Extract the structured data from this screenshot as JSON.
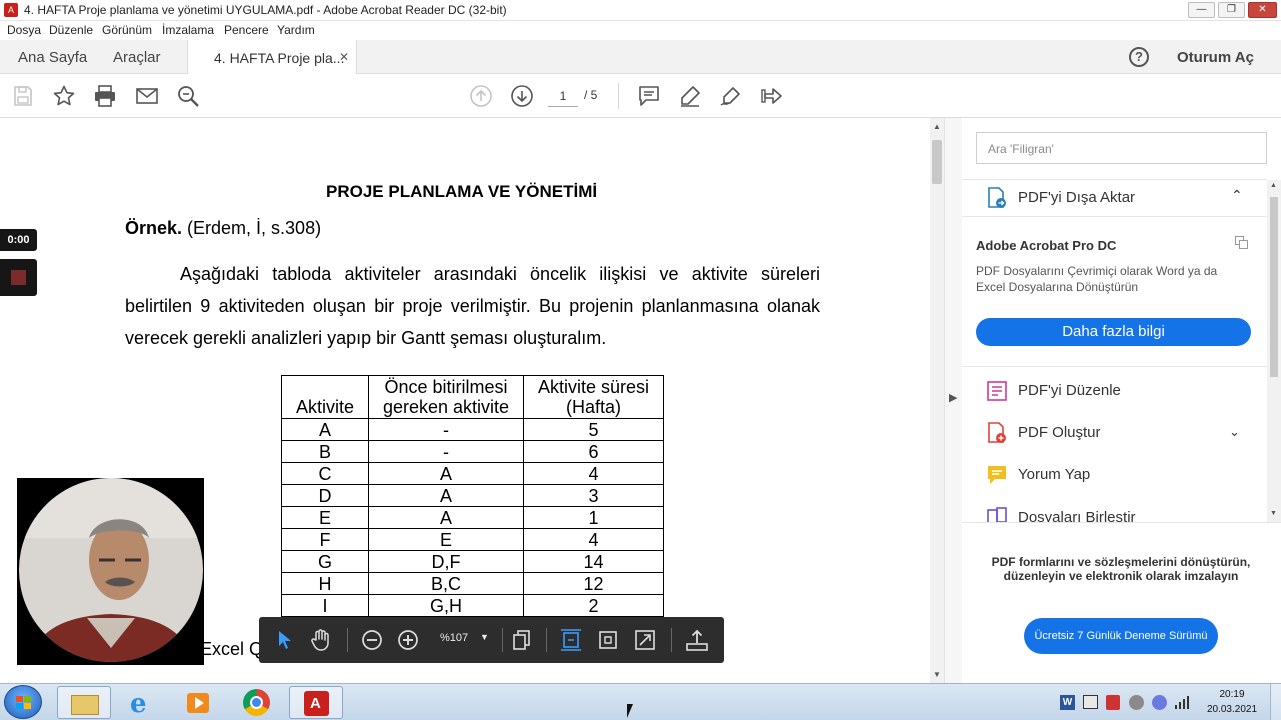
{
  "window": {
    "title": "4. HAFTA Proje planlama ve yönetimi UYGULAMA.pdf - Adobe Acrobat Reader DC (32-bit)",
    "app_icon_glyph": "A",
    "minimize": "—",
    "maximize": "❐",
    "close": "✕"
  },
  "menu": [
    "Dosya",
    "Düzenle",
    "Görünüm",
    "İmzalama",
    "Pencere",
    "Yardım"
  ],
  "tabs": {
    "home": "Ana Sayfa",
    "tools": "Araçlar",
    "document": "4. HAFTA Proje pla...",
    "close_glyph": "✕",
    "help_glyph": "?",
    "sign_in": "Oturum Aç"
  },
  "toolbar": {
    "page_current": "1",
    "page_total": "/ 5",
    "icons": [
      "save-icon",
      "bookmark-star-icon",
      "print-icon",
      "email-icon",
      "zoom-search-icon",
      "page-up-icon",
      "page-down-icon",
      "comment-icon",
      "highlight-pen-icon",
      "sign-icon",
      "share-icon"
    ]
  },
  "document": {
    "title": "PROJE PLANLAMA VE YÖNETİMİ",
    "example_label": "Örnek.",
    "example_ref": " (Erdem, İ, s.308)",
    "paragraph_lines": [
      "Aşağıdaki tabloda aktiviteler arasındaki öncelik ilişkisi ve aktivite süreleri",
      "belirtilen 9 aktiviteden oluşan bir proje verilmiştir. Bu projenin planlanmasına olanak",
      "verecek gerekli analizleri yapıp bir Gantt şeması oluşturalım."
    ],
    "table": {
      "headers": [
        "Aktivite",
        "Önce bitirilmesi\ngereken aktivite",
        "Aktivite süresi\n(Hafta)"
      ],
      "rows": [
        [
          "A",
          "-",
          "5"
        ],
        [
          "B",
          "-",
          "6"
        ],
        [
          "C",
          "A",
          "4"
        ],
        [
          "D",
          "A",
          "3"
        ],
        [
          "E",
          "A",
          "1"
        ],
        [
          "F",
          "E",
          "4"
        ],
        [
          "G",
          "D,F",
          "14"
        ],
        [
          "H",
          "B,C",
          "12"
        ],
        [
          "I",
          "G,H",
          "2"
        ]
      ]
    },
    "partial_text": "Excel Q"
  },
  "float_toolbar": {
    "zoom": "%107",
    "icons": [
      "select-cursor-icon",
      "hand-pan-icon",
      "zoom-out-icon",
      "zoom-in-icon",
      "zoom-dropdown-icon",
      "page-view-icon",
      "fit-page-icon",
      "rotate-icon",
      "fullscreen-icon",
      "export-icon"
    ]
  },
  "recorder": {
    "timer": "0:00"
  },
  "right_panel": {
    "search_placeholder": "Ara 'Filigran'",
    "export_pdf": "PDF'yi Dışa Aktar",
    "promo_title": "Adobe Acrobat Pro DC",
    "promo_text": "PDF Dosyalarını Çevrimiçi olarak Word ya da Excel Dosyalarına Dönüştürün",
    "more_info": "Daha fazla bilgi",
    "tools": [
      "PDF'yi Düzenle",
      "PDF Oluştur",
      "Yorum Yap",
      "Dosyaları Birleştir"
    ],
    "footer_text": "PDF formlarını ve sözleşmelerini dönüştürün, düzenleyin ve elektronik olarak imzalayın",
    "trial_button": "Ücretsiz 7 Günlük Deneme Sürümü"
  },
  "taskbar": {
    "apps": [
      "start-orb",
      "file-explorer",
      "internet-explorer",
      "media-player",
      "chrome",
      "acrobat-reader"
    ],
    "time": "20:19",
    "date": "20.03.2021"
  }
}
